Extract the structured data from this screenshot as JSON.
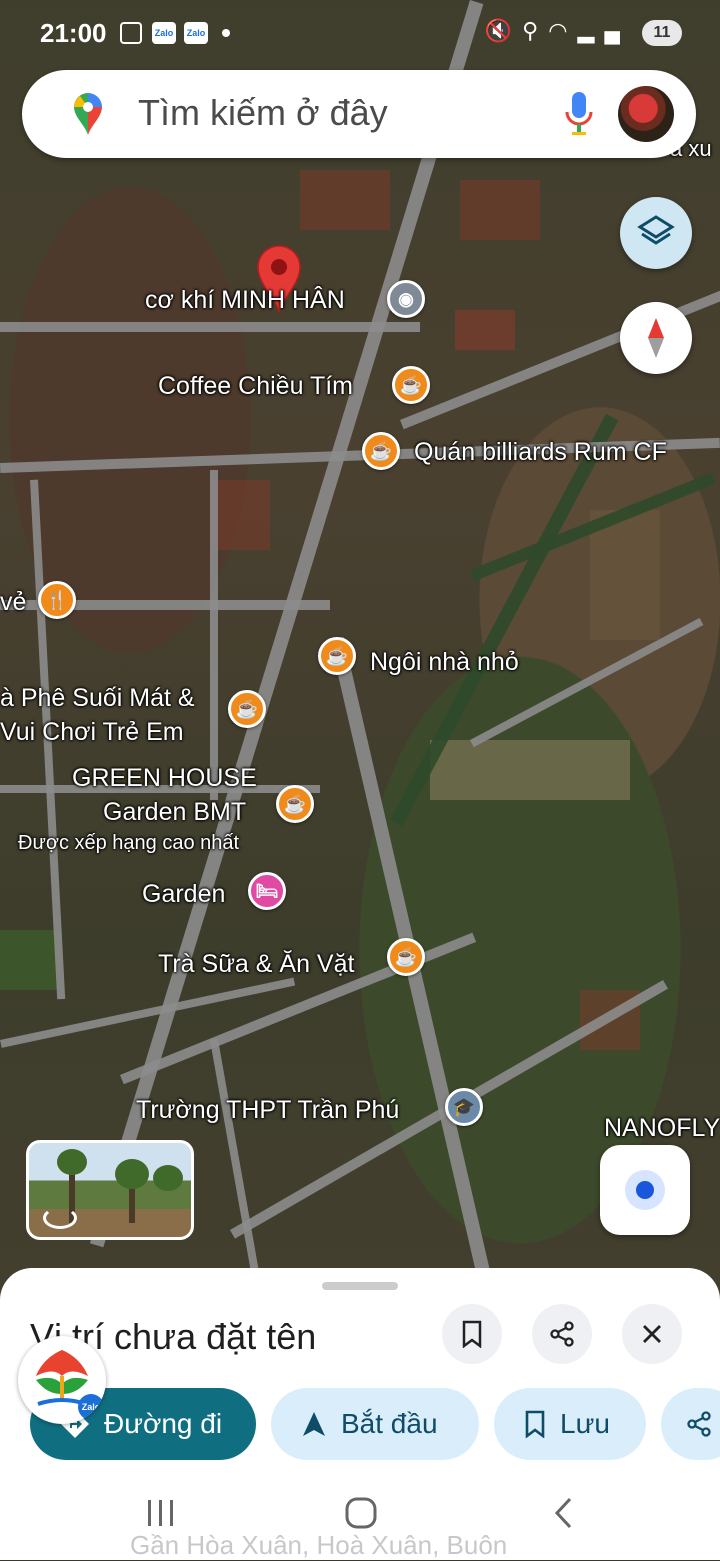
{
  "status_bar": {
    "time": "21:00",
    "notif_1": "Zalo",
    "notif_2": "Zalo",
    "battery": "11"
  },
  "search": {
    "placeholder": "Tìm kiếm ở đây"
  },
  "map": {
    "dropped_pin_label": "cơ khí MINH HÂN",
    "places": [
      {
        "label": "Coffee Chiều Tím",
        "icon": "cafe-icon"
      },
      {
        "label": "Quán billiards Rum CF",
        "icon": "cafe-icon"
      },
      {
        "label": "vẻ",
        "icon": "restaurant-icon"
      },
      {
        "label": "Ngôi nhà nhỏ",
        "icon": "cafe-icon"
      },
      {
        "label": "à Phê Suối Mát &",
        "label2": "Vui Chơi Trẻ Em",
        "icon": "cafe-icon"
      },
      {
        "label": "GREEN HOUSE",
        "label2": "Garden BMT",
        "sub": "Được xếp hạng cao nhất",
        "icon": "cafe-icon"
      },
      {
        "label": "Garden",
        "icon": "hotel-icon"
      },
      {
        "label": "Trà Sữa & Ăn Vặt",
        "icon": "cafe-icon"
      },
      {
        "label": "Trường THPT Trần Phú",
        "icon": "school-icon"
      },
      {
        "label": "NANOFLY",
        "icon": ""
      }
    ],
    "edge_label": "a xu"
  },
  "sheet": {
    "title": "Vị trí chưa đặt tên",
    "buttons": {
      "directions": "Đường đi",
      "start": "Bắt đầu",
      "save": "Lưu"
    },
    "address_partial": "Gần Hòa Xuân, Hoà Xuân, Buôn"
  },
  "colors": {
    "primary": "#0f6e80",
    "chip": "#d9eefa",
    "cafe": "#f08a1b",
    "hotel": "#e14aa3",
    "pin": "#e53935"
  }
}
